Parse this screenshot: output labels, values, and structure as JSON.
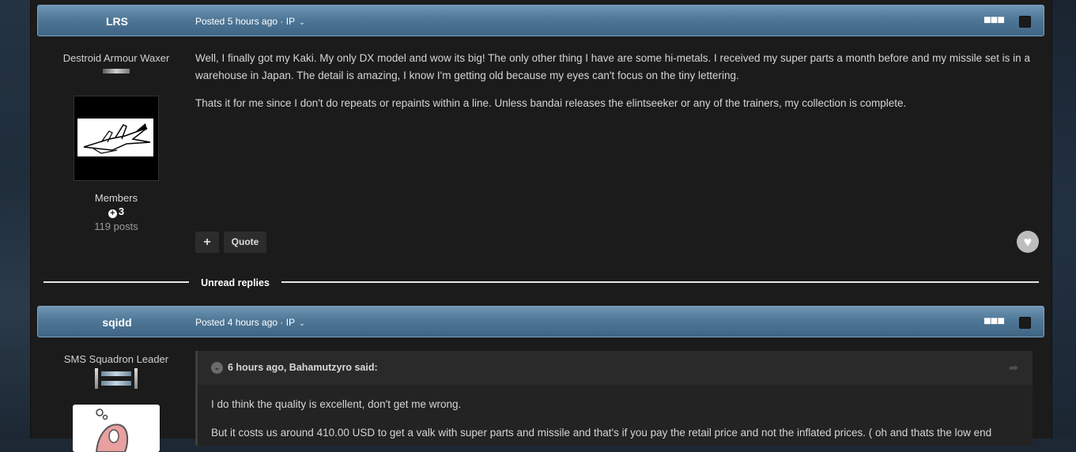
{
  "posts": [
    {
      "author": "LRS",
      "posted": "Posted 5 hours ago",
      "ip": "IP",
      "rank_title": "Destroid Armour Waxer",
      "group": "Members",
      "reputation": "3",
      "post_count": "119 posts",
      "paragraphs": [
        "Well, I finally got my Kaki. My only DX model and wow its big! The only other thing I have are some hi-metals. I received my super parts a month before and my missile set is in a warehouse in Japan. The detail is amazing, I know I'm getting old because my eyes can't focus on the tiny lettering.",
        "Thats it for me since I don't do repeats or repaints within a line. Unless bandai releases the elintseeker or any of the trainers, my collection is complete."
      ],
      "quote_button": "Quote"
    },
    {
      "author": "sqidd",
      "posted": "Posted 4 hours ago",
      "ip": "IP",
      "rank_title": "SMS Squadron Leader",
      "quote": {
        "header": "6 hours ago, Bahamutzyro said:",
        "lines": [
          "I do think the quality is excellent, don't get me wrong.",
          "But it costs us around 410.00 USD to get a valk with super parts and missile and that's if you pay the retail price and not the inflated prices. ( oh and thats the low end"
        ]
      }
    }
  ],
  "separator": {
    "label": "Unread replies"
  },
  "icons": {
    "more": "ellipsis-icon",
    "plus": "plus-icon",
    "heart": "heart-icon",
    "chevron": "chevron-down-icon",
    "share": "share-icon"
  },
  "colors": {
    "header_blue": "#4f7797",
    "panel": "#1b1b1b"
  }
}
